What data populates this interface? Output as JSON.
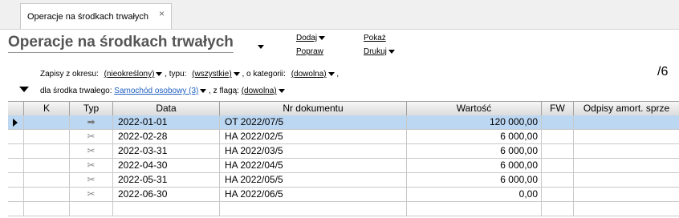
{
  "tab": {
    "label": "Operacje na środkach trwałych",
    "close_glyph": "×"
  },
  "page": {
    "title": "Operacje na środkach trwałych"
  },
  "actions": {
    "dodaj": "Dodaj",
    "popraw": "Popraw",
    "pokaz": "Pokaż",
    "drukuj": "Drukuj"
  },
  "filters": {
    "okres_label": "Zapisy z okresu:",
    "okres_value": "(nieokreślony)",
    "typu_label": ", typu:",
    "typu_value": "(wszystkie)",
    "kategorii_label": ", o kategorii:",
    "kategorii_value": "(dowolna)",
    "trailing_comma": ",",
    "srodek_label": "dla środka trwałego:",
    "srodek_value": "Samochód osobowy (3)",
    "flaga_label": ", z flagą:",
    "flaga_value": "(dowolna)"
  },
  "count": "/6",
  "table": {
    "columns": [
      "K",
      "Typ",
      "Data",
      "Nr dokumentu",
      "Wartość",
      "FW",
      "Odpisy amort. sprze"
    ],
    "rows": [
      {
        "typ_icon": "arrow-right-icon",
        "data": "2022-01-01",
        "nr": "OT 2022/07/5",
        "wartosc": "120 000,00"
      },
      {
        "typ_icon": "scissors-icon",
        "data": "2022-02-28",
        "nr": "HA 2022/02/5",
        "wartosc": "6 000,00"
      },
      {
        "typ_icon": "scissors-icon",
        "data": "2022-03-31",
        "nr": "HA 2022/03/5",
        "wartosc": "6 000,00"
      },
      {
        "typ_icon": "scissors-icon",
        "data": "2022-04-30",
        "nr": "HA 2022/04/5",
        "wartosc": "6 000,00"
      },
      {
        "typ_icon": "scissors-icon",
        "data": "2022-05-31",
        "nr": "HA 2022/05/5",
        "wartosc": "6 000,00"
      },
      {
        "typ_icon": "scissors-icon",
        "data": "2022-06-30",
        "nr": "HA 2022/06/5",
        "wartosc": "0,00"
      }
    ]
  },
  "colors": {
    "selected_row": "#bcd7f2",
    "filter_link": "#1f5fbf"
  }
}
